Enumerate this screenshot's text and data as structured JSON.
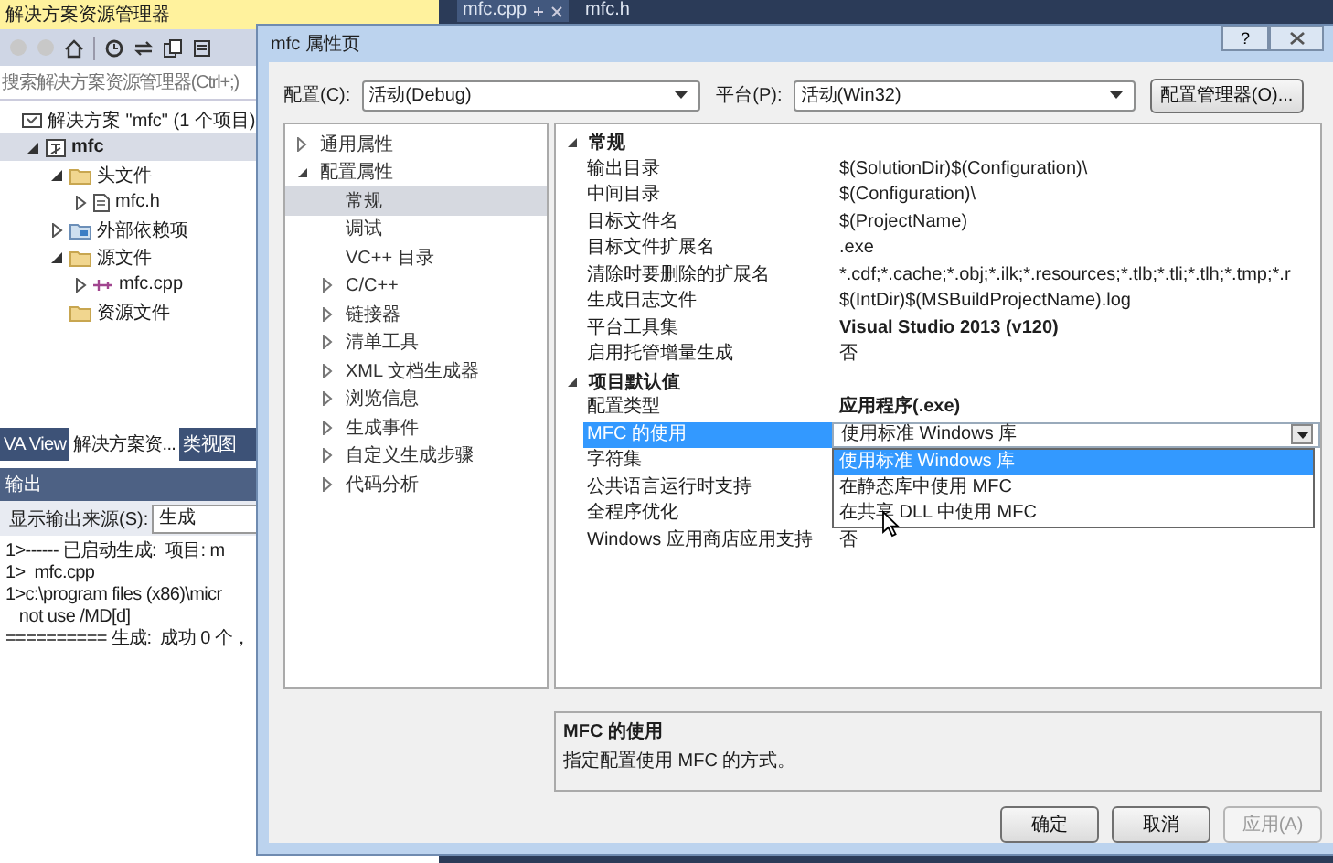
{
  "solution_explorer": {
    "title": "解决方案资源管理器",
    "search": {
      "placeholder": "搜索解决方案资源管理器(Ctrl+;)"
    },
    "tree": [
      {
        "label": "解决方案 \"mfc\" (1 个项目)",
        "kind": "solution",
        "selected": false,
        "children": [
          {
            "label": "mfc",
            "kind": "project",
            "selected": true,
            "expanded": true,
            "children": [
              {
                "label": "头文件",
                "kind": "folder",
                "selected": false,
                "expanded": true,
                "children": [
                  {
                    "label": "mfc.h",
                    "kind": "header",
                    "selected": false,
                    "expanded": false
                  }
                ]
              },
              {
                "label": "外部依赖项",
                "kind": "deps",
                "selected": false,
                "expanded": false
              },
              {
                "label": "源文件",
                "kind": "folder",
                "selected": false,
                "expanded": true,
                "children": [
                  {
                    "label": "mfc.cpp",
                    "kind": "source",
                    "selected": false,
                    "expanded": false
                  }
                ]
              },
              {
                "label": "资源文件",
                "kind": "folder",
                "selected": false
              }
            ]
          }
        ]
      }
    ],
    "tabs": [
      {
        "label": "VA View",
        "selected": false
      },
      {
        "label": "解决方案资...",
        "selected": true
      },
      {
        "label": "类视图",
        "selected": false
      }
    ]
  },
  "output": {
    "title": "输出",
    "source_label": "显示输出来源(S):",
    "source_value": "生成",
    "lines": [
      "1>------ 已启动生成:  项目: m",
      "1>  mfc.cpp",
      "1>c:\\program files (x86)\\micr",
      "   not use /MD[d]",
      "========== 生成:  成功 0 个，"
    ]
  },
  "editor_tabs": [
    {
      "label": "mfc.cpp",
      "selected": true
    },
    {
      "label": "mfc.h",
      "selected": false
    }
  ],
  "dialog": {
    "title": "mfc 属性页",
    "help_button": "?",
    "config_label": "配置(C):",
    "config_value": "活动(Debug)",
    "platform_label": "平台(P):",
    "platform_value": "活动(Win32)",
    "manager_button": "配置管理器(O)...",
    "nav": [
      {
        "label": "通用属性",
        "selected": false,
        "expanded": false
      },
      {
        "label": "配置属性",
        "selected": false,
        "expanded": true,
        "children": [
          {
            "label": "常规",
            "selected": true
          },
          {
            "label": "调试",
            "selected": false
          },
          {
            "label": "VC++ 目录",
            "selected": false
          },
          {
            "label": "C/C++",
            "selected": false,
            "expanded": false
          },
          {
            "label": "链接器",
            "selected": false,
            "expanded": false
          },
          {
            "label": "清单工具",
            "selected": false,
            "expanded": false
          },
          {
            "label": "XML 文档生成器",
            "selected": false,
            "expanded": false
          },
          {
            "label": "浏览信息",
            "selected": false,
            "expanded": false
          },
          {
            "label": "生成事件",
            "selected": false,
            "expanded": false
          },
          {
            "label": "自定义生成步骤",
            "selected": false,
            "expanded": false
          },
          {
            "label": "代码分析",
            "selected": false,
            "expanded": false
          }
        ]
      }
    ],
    "sections": [
      {
        "title": "常规",
        "expanded": true,
        "rows": [
          {
            "name": "输出目录",
            "value": "$(SolutionDir)$(Configuration)\\",
            "bold": false,
            "selected": false
          },
          {
            "name": "中间目录",
            "value": "$(Configuration)\\",
            "bold": false,
            "selected": false
          },
          {
            "name": "目标文件名",
            "value": "$(ProjectName)",
            "bold": false,
            "selected": false
          },
          {
            "name": "目标文件扩展名",
            "value": ".exe",
            "bold": false,
            "selected": false
          },
          {
            "name": "清除时要删除的扩展名",
            "value": "*.cdf;*.cache;*.obj;*.ilk;*.resources;*.tlb;*.tli;*.tlh;*.tmp;*.r",
            "bold": false,
            "selected": false
          },
          {
            "name": "生成日志文件",
            "value": "$(IntDir)$(MSBuildProjectName).log",
            "bold": false,
            "selected": false
          },
          {
            "name": "平台工具集",
            "value": "Visual Studio 2013 (v120)",
            "bold": true,
            "selected": false
          },
          {
            "name": "启用托管增量生成",
            "value": "否",
            "bold": false,
            "selected": false
          }
        ]
      },
      {
        "title": "项目默认值",
        "expanded": true,
        "rows": [
          {
            "name": "配置类型",
            "value": "应用程序(.exe)",
            "bold": true,
            "selected": false
          },
          {
            "name": "MFC 的使用",
            "value": "使用标准 Windows 库",
            "bold": false,
            "selected": true,
            "options": [
              {
                "label": "使用标准 Windows 库",
                "selected": true
              },
              {
                "label": "在静态库中使用 MFC",
                "selected": false
              },
              {
                "label": "在共享 DLL 中使用 MFC",
                "selected": false
              }
            ]
          },
          {
            "name": "字符集",
            "selected": false
          },
          {
            "name": "公共语言运行时支持",
            "selected": false
          },
          {
            "name": "全程序优化",
            "selected": false
          },
          {
            "name": "Windows 应用商店应用支持",
            "value": "否",
            "bold": false,
            "selected": false
          }
        ]
      }
    ],
    "description": {
      "title": "MFC 的使用",
      "text": "指定配置使用 MFC 的方式。"
    },
    "buttons": [
      {
        "label": "确定",
        "disabled": false
      },
      {
        "label": "取消",
        "disabled": false
      },
      {
        "label": "应用(A)",
        "disabled": true
      }
    ]
  }
}
